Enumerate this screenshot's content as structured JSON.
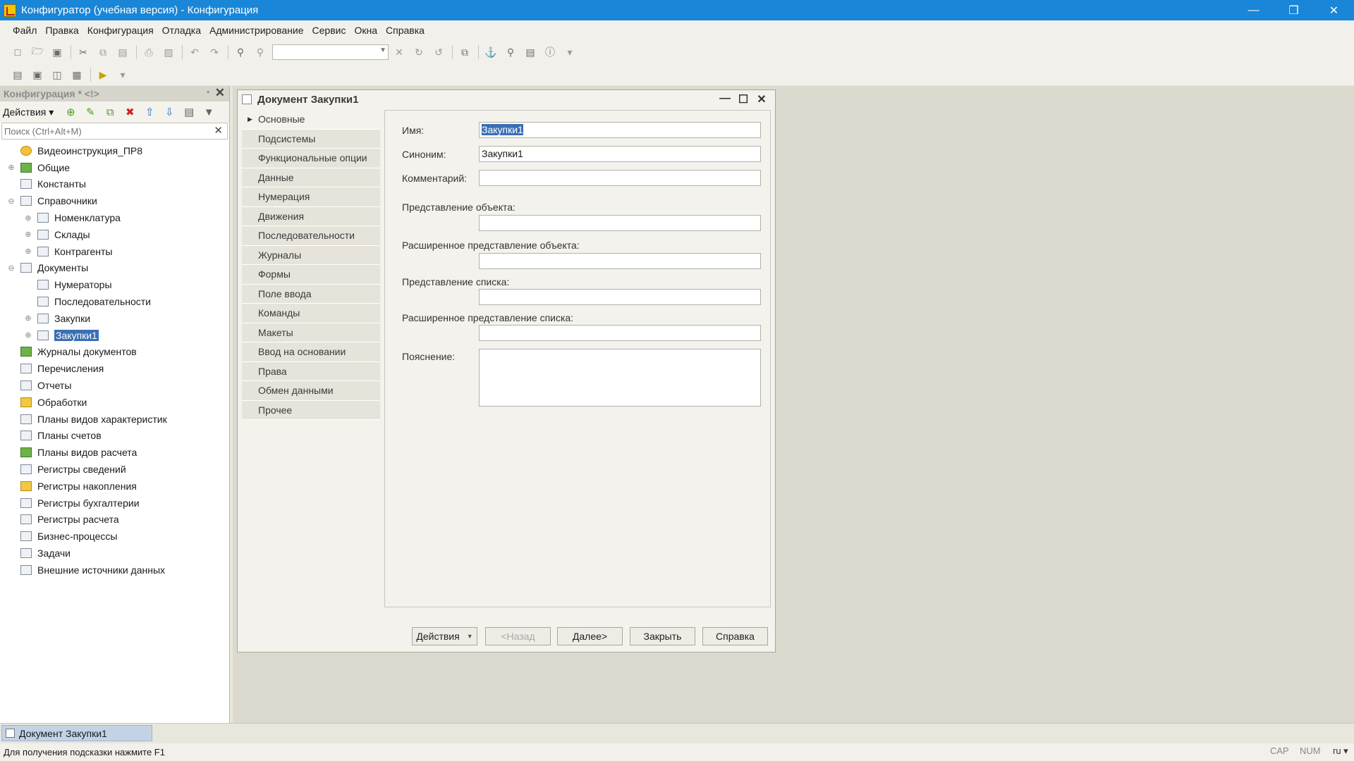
{
  "window": {
    "title": "Конфигуратор (учебная версия) - Конфигурация",
    "controls": [
      "—",
      "❐",
      "✕"
    ]
  },
  "menu": [
    "Файл",
    "Правка",
    "Конфигурация",
    "Отладка",
    "Администрирование",
    "Сервис",
    "Окна",
    "Справка"
  ],
  "config_panel": {
    "title": "Конфигурация * <!>",
    "actions_label": "Действия ▾",
    "search_placeholder": "Поиск (Ctrl+Alt+M)",
    "tree": [
      {
        "label": "Видеоинструкция_ПР8",
        "level": 0,
        "expander": "",
        "icon": "root-config-icon"
      },
      {
        "label": "Общие",
        "level": 0,
        "expander": "⊕",
        "icon": "common-icon"
      },
      {
        "label": "Константы",
        "level": 0,
        "expander": "",
        "icon": "constants-icon"
      },
      {
        "label": "Справочники",
        "level": 0,
        "expander": "⊖",
        "icon": "catalogs-icon"
      },
      {
        "label": "Номенклатура",
        "level": 1,
        "expander": "⊕",
        "icon": "catalog-icon"
      },
      {
        "label": "Склады",
        "level": 1,
        "expander": "⊕",
        "icon": "catalog-icon"
      },
      {
        "label": "Контрагенты",
        "level": 1,
        "expander": "⊕",
        "icon": "catalog-icon"
      },
      {
        "label": "Документы",
        "level": 0,
        "expander": "⊖",
        "icon": "documents-icon"
      },
      {
        "label": "Нумераторы",
        "level": 1,
        "expander": "",
        "icon": "numerators-icon"
      },
      {
        "label": "Последовательности",
        "level": 1,
        "expander": "",
        "icon": "sequences-icon"
      },
      {
        "label": "Закупки",
        "level": 1,
        "expander": "⊕",
        "icon": "document-icon"
      },
      {
        "label": "Закупки1",
        "level": 1,
        "expander": "⊕",
        "icon": "document-icon",
        "selected": true
      },
      {
        "label": "Журналы документов",
        "level": 0,
        "expander": "",
        "icon": "journals-icon"
      },
      {
        "label": "Перечисления",
        "level": 0,
        "expander": "",
        "icon": "enums-icon"
      },
      {
        "label": "Отчеты",
        "level": 0,
        "expander": "",
        "icon": "reports-icon"
      },
      {
        "label": "Обработки",
        "level": 0,
        "expander": "",
        "icon": "processing-icon"
      },
      {
        "label": "Планы видов характеристик",
        "level": 0,
        "expander": "",
        "icon": "chart-of-characteristics-icon"
      },
      {
        "label": "Планы счетов",
        "level": 0,
        "expander": "",
        "icon": "chart-of-accounts-icon"
      },
      {
        "label": "Планы видов расчета",
        "level": 0,
        "expander": "",
        "icon": "chart-of-calculation-icon"
      },
      {
        "label": "Регистры сведений",
        "level": 0,
        "expander": "",
        "icon": "info-registers-icon"
      },
      {
        "label": "Регистры накопления",
        "level": 0,
        "expander": "",
        "icon": "accumulation-registers-icon"
      },
      {
        "label": "Регистры бухгалтерии",
        "level": 0,
        "expander": "",
        "icon": "accounting-registers-icon"
      },
      {
        "label": "Регистры расчета",
        "level": 0,
        "expander": "",
        "icon": "calculation-registers-icon"
      },
      {
        "label": "Бизнес-процессы",
        "level": 0,
        "expander": "",
        "icon": "business-processes-icon"
      },
      {
        "label": "Задачи",
        "level": 0,
        "expander": "",
        "icon": "tasks-icon"
      },
      {
        "label": "Внешние источники данных",
        "level": 0,
        "expander": "",
        "icon": "external-sources-icon"
      }
    ]
  },
  "document": {
    "title": "Документ Закупки1",
    "tabs": [
      "Основные",
      "Подсистемы",
      "Функциональные опции",
      "Данные",
      "Нумерация",
      "Движения",
      "Последовательности",
      "Журналы",
      "Формы",
      "Поле ввода",
      "Команды",
      "Макеты",
      "Ввод на основании",
      "Права",
      "Обмен данными",
      "Прочее"
    ],
    "fields": {
      "name_label": "Имя:",
      "name_value": "Закупки1",
      "synonym_label": "Синоним:",
      "synonym_value": "Закупки1",
      "comment_label": "Комментарий:",
      "comment_value": "",
      "object_repr_label": "Представление объекта:",
      "ext_object_repr_label": "Расширенное представление объекта:",
      "list_repr_label": "Представление списка:",
      "ext_list_repr_label": "Расширенное представление списка:",
      "explanation_label": "Пояснение:"
    },
    "buttons": {
      "actions": "Действия",
      "back": "<Назад",
      "next": "Далее>",
      "close": "Закрыть",
      "help": "Справка"
    }
  },
  "window_bar": {
    "tab": "Документ Закупки1"
  },
  "status": {
    "hint": "Для получения подсказки нажмите F1",
    "cap": "CAP",
    "num": "NUM",
    "lang": "ru ▾"
  }
}
